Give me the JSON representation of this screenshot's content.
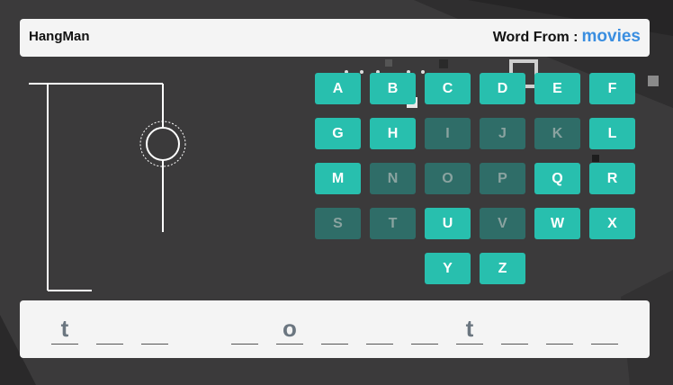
{
  "header": {
    "title": "HangMan",
    "word_from_label": "Word From :",
    "category": "movies"
  },
  "keyboard": [
    {
      "letter": "A",
      "used": false
    },
    {
      "letter": "B",
      "used": false
    },
    {
      "letter": "C",
      "used": false
    },
    {
      "letter": "D",
      "used": false
    },
    {
      "letter": "E",
      "used": false
    },
    {
      "letter": "F",
      "used": false
    },
    {
      "letter": "G",
      "used": false
    },
    {
      "letter": "H",
      "used": false
    },
    {
      "letter": "I",
      "used": true
    },
    {
      "letter": "J",
      "used": true
    },
    {
      "letter": "K",
      "used": true
    },
    {
      "letter": "L",
      "used": false
    },
    {
      "letter": "M",
      "used": false
    },
    {
      "letter": "N",
      "used": true
    },
    {
      "letter": "O",
      "used": true
    },
    {
      "letter": "P",
      "used": true
    },
    {
      "letter": "Q",
      "used": false
    },
    {
      "letter": "R",
      "used": false
    },
    {
      "letter": "S",
      "used": true
    },
    {
      "letter": "T",
      "used": true
    },
    {
      "letter": "U",
      "used": false
    },
    {
      "letter": "V",
      "used": true
    },
    {
      "letter": "W",
      "used": false
    },
    {
      "letter": "X",
      "used": false
    },
    {
      "letter": "Y",
      "used": false
    },
    {
      "letter": "Z",
      "used": false
    }
  ],
  "answer": {
    "words": [
      [
        "t",
        "",
        ""
      ],
      [
        "",
        "o",
        "",
        "",
        "",
        "t",
        "",
        "",
        ""
      ]
    ]
  },
  "colors": {
    "key": "#28bfae",
    "key_used": "#2f6d68",
    "category": "#3a8ee0",
    "background": "#3b3a3b"
  }
}
